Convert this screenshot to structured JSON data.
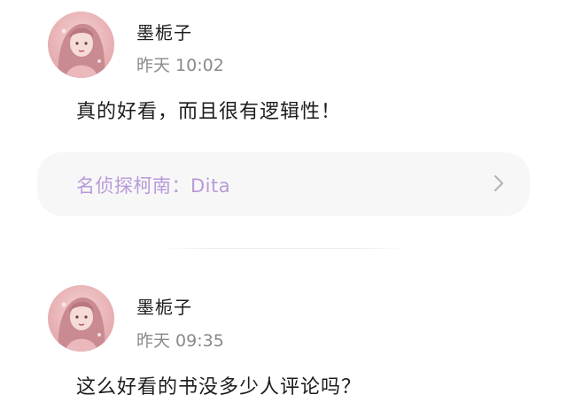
{
  "comments": [
    {
      "username": "墨栀子",
      "time": "昨天 10:02",
      "text": "真的好看，而且很有逻辑性！"
    },
    {
      "username": "墨栀子",
      "time": "昨天 09:35",
      "text": "这么好看的书没多少人评论吗？"
    }
  ],
  "book_link": {
    "label": "名侦探柯南：Dita",
    "icon": "chevron-right-icon"
  },
  "colors": {
    "book_link_text": "#b99ad8",
    "card_background": "#f7f7f8",
    "time_text": "#8a8a8a"
  }
}
